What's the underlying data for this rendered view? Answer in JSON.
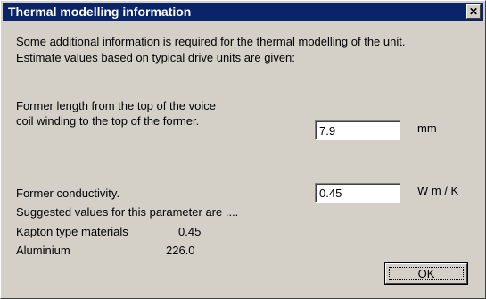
{
  "window": {
    "title": "Thermal modelling information",
    "close_label": "✕"
  },
  "intro": {
    "line1": "Some additional information is required for the thermal modelling of the unit.",
    "line2": "Estimate values based on typical drive units are given:"
  },
  "former_length": {
    "label_line1": "Former length from the top of the voice",
    "label_line2": "coil winding to the top of the former.",
    "value": "7.9",
    "unit": "mm"
  },
  "former_conductivity": {
    "label": "Former conductivity.",
    "value": "0.45",
    "unit": "W m / K"
  },
  "suggestions": {
    "heading": "Suggested values for this parameter are ....",
    "rows": [
      {
        "material": "Kapton type materials",
        "value": "0.45"
      },
      {
        "material": "Aluminium",
        "value": "226.0"
      }
    ]
  },
  "buttons": {
    "ok_label": "OK"
  },
  "colors": {
    "titlebar": "#0a246a",
    "face": "#d4d0c8"
  }
}
